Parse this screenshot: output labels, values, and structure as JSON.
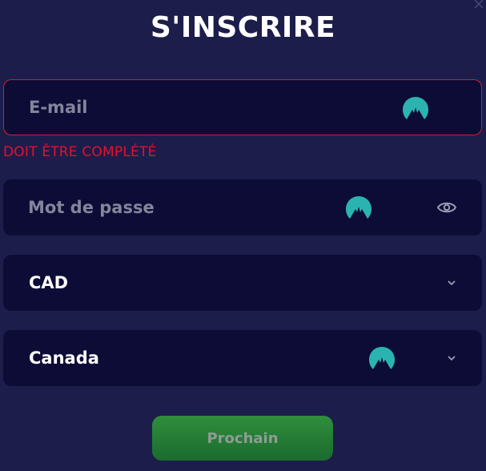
{
  "title": "S'INSCRIRE",
  "email": {
    "placeholder": "E-mail",
    "value": "",
    "error": "DOIT ÊTRE COMPLÉTÉ"
  },
  "password": {
    "placeholder": "Mot de passe",
    "value": ""
  },
  "currency": {
    "selected": "CAD"
  },
  "country": {
    "selected": "Canada"
  },
  "next_button": {
    "label": "Prochain"
  },
  "colors": {
    "background": "#1d1d4b",
    "field_background": "#0c0c36",
    "error": "#e0132b",
    "icon_teal": "#2bb3b1",
    "button_green": "#2a8a3a"
  },
  "icons": {
    "extension": "nordpass-icon",
    "show_password": "eye-icon",
    "dropdown": "chevron-down-icon",
    "close": "close-icon"
  }
}
